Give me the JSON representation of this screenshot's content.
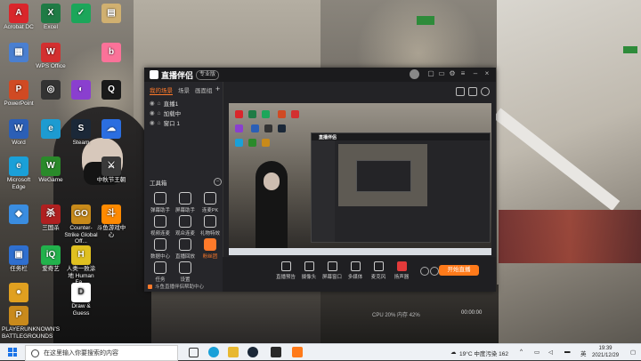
{
  "desktop": {
    "icons_left": [
      {
        "label": "Acrobat DC",
        "icon": "acrobat-icon",
        "color": "#d9262b",
        "glyph": "A"
      },
      {
        "label": "",
        "icon": "folder-icon",
        "color": "#4a7fd0",
        "glyph": "▦"
      },
      {
        "label": "PowerPoint",
        "icon": "powerpoint-icon",
        "color": "#d04a23",
        "glyph": "P"
      },
      {
        "label": "Word",
        "icon": "word-icon",
        "color": "#2b5fb6",
        "glyph": "W"
      },
      {
        "label": "Microsoft Edge",
        "icon": "edge-icon",
        "color": "#1aa0d8",
        "glyph": "e"
      },
      {
        "label": "",
        "icon": "app-icon",
        "color": "#3a8de0",
        "glyph": "◆"
      },
      {
        "label": "任务栏",
        "icon": "computer-icon",
        "color": "#2f6fcf",
        "glyph": "▣"
      },
      {
        "label": "",
        "icon": "pet-icon",
        "color": "#e0a020",
        "glyph": "●"
      },
      {
        "label": "PLAYERUNKNOWN'S BATTLEGROUNDS",
        "icon": "game-icon",
        "color": "#c98a1c",
        "glyph": "P"
      }
    ],
    "icons_col2": [
      {
        "label": "Excel",
        "icon": "excel-icon",
        "color": "#1f7b45",
        "glyph": "X"
      },
      {
        "label": "WPS Office",
        "icon": "wps-icon",
        "color": "#d33030",
        "glyph": "W"
      },
      {
        "label": "",
        "icon": "app2-icon",
        "color": "#333",
        "glyph": "◎"
      },
      {
        "label": "",
        "icon": "browser-icon",
        "color": "#1d9bd1",
        "glyph": "e"
      },
      {
        "label": "WeGame",
        "icon": "wegame-icon",
        "color": "#2a8a2a",
        "glyph": "W"
      },
      {
        "label": "三国杀",
        "icon": "sanguosha-icon",
        "color": "#b02020",
        "glyph": "杀"
      },
      {
        "label": "爱奇艺",
        "icon": "iqiyi-icon",
        "color": "#22b24c",
        "glyph": "iQ"
      }
    ],
    "icons_col3": [
      {
        "label": "",
        "icon": "wechat-work-icon",
        "color": "#1ca65a",
        "glyph": "✓"
      },
      {
        "label": "",
        "icon": "app3-icon",
        "color": "#8a3fcf",
        "glyph": "◐"
      },
      {
        "label": "Steam",
        "icon": "steam-icon",
        "color": "#1b2838",
        "glyph": "S"
      },
      {
        "label": "Counter-Strike Global Off...",
        "icon": "csgo-icon",
        "color": "#c88a1a",
        "glyph": "GO"
      },
      {
        "label": "人类一败涂地 Human Fa...",
        "icon": "human-icon",
        "color": "#e0c020",
        "glyph": "H"
      },
      {
        "label": "Draw & Guess",
        "icon": "drawguess-icon",
        "color": "#ffffff",
        "glyph": "D"
      }
    ],
    "icons_col4": [
      {
        "label": "",
        "icon": "app4-icon",
        "color": "#d0b070",
        "glyph": "▤"
      },
      {
        "label": "",
        "icon": "bilibili-icon",
        "color": "#fb7299",
        "glyph": "b"
      },
      {
        "label": "",
        "icon": "qq-icon",
        "color": "#1a1a1a",
        "glyph": "Q"
      },
      {
        "label": "",
        "icon": "app5-icon",
        "color": "#2b6ee0",
        "glyph": "☁"
      },
      {
        "label": "中秋节王朝",
        "icon": "game2-icon",
        "color": "#3a3a3a",
        "glyph": "⚔"
      },
      {
        "label": "斗鱼游戏中心",
        "icon": "douyu-icon",
        "color": "#ff8a00",
        "glyph": "斗"
      }
    ]
  },
  "window": {
    "title": "直播伴侣",
    "version": "专业版",
    "sidebar_tabs": [
      {
        "label": "我的场景",
        "active": true
      },
      {
        "label": "场景",
        "active": false
      },
      {
        "label": "画面组",
        "active": false
      }
    ],
    "scenes": [
      {
        "label": "直播1"
      },
      {
        "label": "加载中"
      },
      {
        "label": "窗口 1"
      }
    ],
    "tools_title": "工具箱",
    "tools": [
      {
        "label": "弹幕助手",
        "icon": "danmu-icon",
        "hot": false
      },
      {
        "label": "屏幕助手",
        "icon": "screen-icon",
        "hot": false
      },
      {
        "label": "连麦PK",
        "icon": "pk-icon",
        "hot": false
      },
      {
        "label": "视频连麦",
        "icon": "video-icon",
        "hot": false
      },
      {
        "label": "观众连麦",
        "icon": "audience-icon",
        "hot": false
      },
      {
        "label": "礼物特效",
        "icon": "gift-icon",
        "hot": false
      },
      {
        "label": "数据中心",
        "icon": "data-icon",
        "hot": false
      },
      {
        "label": "直播回放",
        "icon": "replay-icon",
        "hot": false
      },
      {
        "label": "粉丝团",
        "icon": "fans-icon",
        "hot": true
      },
      {
        "label": "任务",
        "icon": "task-icon",
        "hot": false
      },
      {
        "label": "设置",
        "icon": "settings-icon",
        "hot": false
      }
    ],
    "side_footer": "斗鱼直播伴侣帮助中心",
    "bottom_buttons": [
      {
        "label": "直播预告",
        "icon": "preview-icon"
      },
      {
        "label": "摄像头",
        "icon": "camera-icon"
      },
      {
        "label": "屏幕窗口",
        "icon": "window-icon"
      },
      {
        "label": "多媒体",
        "icon": "media-icon"
      },
      {
        "label": "麦克风",
        "icon": "mic-icon"
      },
      {
        "label": "扬声器",
        "icon": "speaker-icon"
      }
    ],
    "start_button": "开始直播",
    "rec_time": "00:00:00",
    "rec_stats": "CPU 20%  内存 42%"
  },
  "taskbar": {
    "search_placeholder": "在这里输入你要搜索的内容",
    "weather": "19°C 中度污染 162",
    "lang": "英",
    "time": "19:39",
    "date": "2021/12/29"
  }
}
